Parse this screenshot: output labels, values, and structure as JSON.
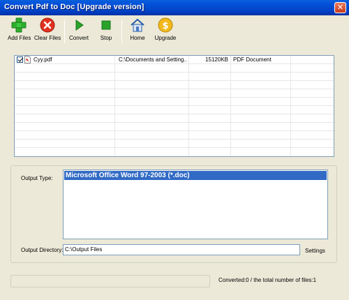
{
  "window": {
    "title": "Convert Pdf to Doc [Upgrade version]",
    "close_symbol": "✕"
  },
  "toolbar": {
    "add_files": "Add Files",
    "clear_files": "Clear Files",
    "convert": "Convert",
    "stop": "Stop",
    "home": "Home",
    "upgrade": "Upgrade",
    "icons": [
      "plus-icon",
      "clear-icon",
      "play-icon",
      "stop-icon",
      "home-icon",
      "dollar-icon"
    ]
  },
  "files": [
    {
      "checked": true,
      "name": "Cyy.pdf",
      "path": "C:\\Documents and Setting...",
      "size": "15120KB",
      "type": "PDF Document"
    }
  ],
  "output": {
    "type_label": "Output Type:",
    "types": [
      "Microsoft Office Word 97-2003 (*.doc)"
    ],
    "directory_label": "Output Directory:",
    "directory_value": "C:\\Output Files",
    "settings": "Settings"
  },
  "status": {
    "text": "Converted:0  /  the total number of files:1",
    "progress": 0
  },
  "colors": {
    "title_bar": "#0044c8",
    "selection": "#316ac5",
    "face": "#ece9d8"
  }
}
